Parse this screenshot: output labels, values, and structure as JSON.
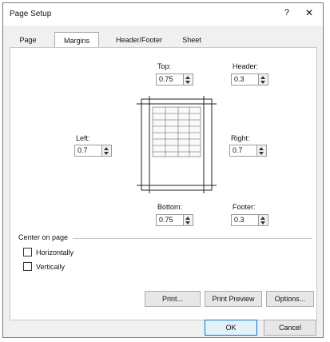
{
  "window": {
    "title": "Page Setup",
    "help_glyph": "?",
    "close_glyph": "✕"
  },
  "tabs": [
    {
      "label": "Page"
    },
    {
      "label": "Margins"
    },
    {
      "label": "Header/Footer"
    },
    {
      "label": "Sheet"
    }
  ],
  "margins": {
    "top": {
      "label": "Top:",
      "value": "0.75"
    },
    "header": {
      "label": "Header:",
      "value": "0.3"
    },
    "left": {
      "label": "Left:",
      "value": "0.7"
    },
    "right": {
      "label": "Right:",
      "value": "0.7"
    },
    "bottom": {
      "label": "Bottom:",
      "value": "0.75"
    },
    "footer": {
      "label": "Footer:",
      "value": "0.3"
    }
  },
  "center_on_page": {
    "heading": "Center on page",
    "horizontally": {
      "label": "Horizontally",
      "checked": false
    },
    "vertically": {
      "label": "Vertically",
      "checked": false
    }
  },
  "buttons": {
    "print": "Print...",
    "print_preview": "Print Preview",
    "options": "Options...",
    "ok": "OK",
    "cancel": "Cancel"
  }
}
